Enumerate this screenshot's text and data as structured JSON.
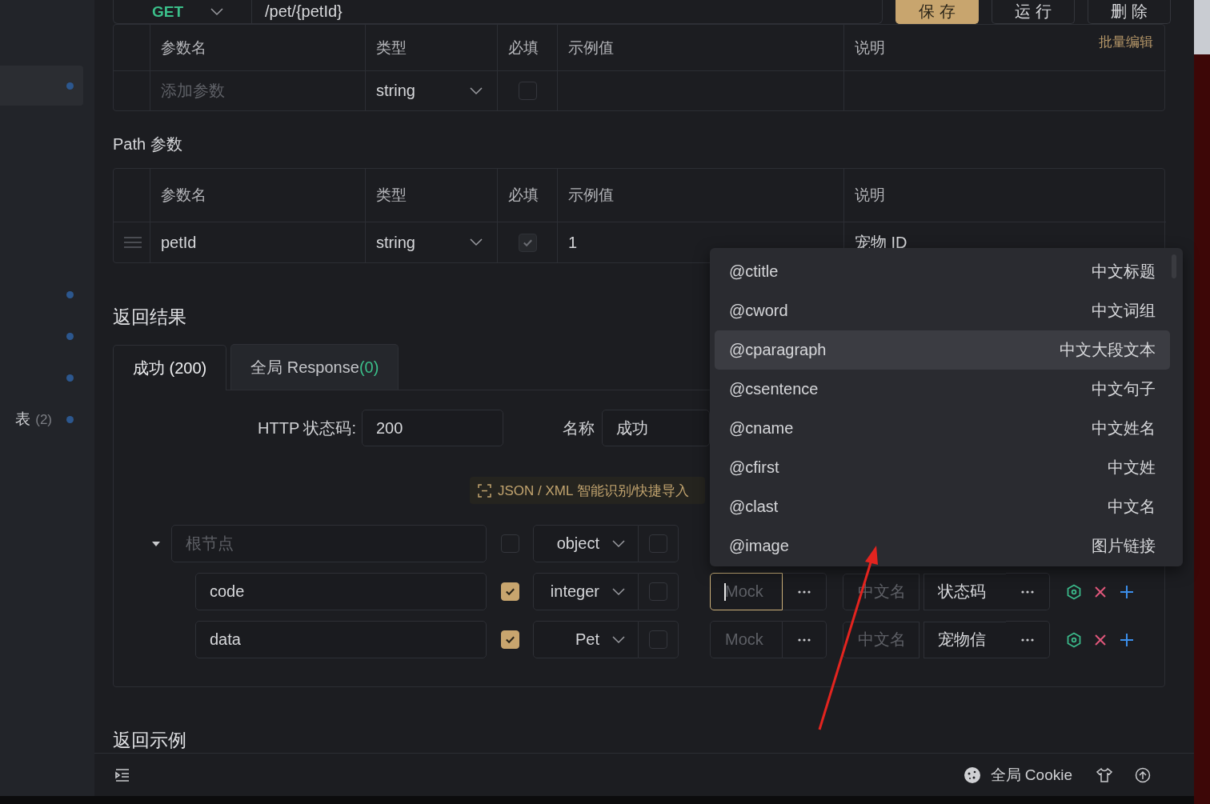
{
  "sidebar": {
    "items": [
      {
        "selected": true
      },
      {
        "selected": false
      },
      {
        "selected": false
      },
      {
        "selected": false
      },
      {
        "label": "表",
        "count": "(2)",
        "selected": false
      }
    ]
  },
  "request": {
    "method": "GET",
    "url": "/pet/{petId}",
    "buttons": [
      {
        "label": "保 存",
        "kind": "primary"
      },
      {
        "label": "运 行",
        "kind": "default"
      },
      {
        "label": "删 除",
        "kind": "default"
      }
    ]
  },
  "query_params": {
    "batch_edit": "批量编辑",
    "columns": [
      "参数名",
      "类型",
      "必填",
      "示例值",
      "说明"
    ],
    "rows": [
      {
        "name_placeholder": "添加参数",
        "type": "string",
        "required": false
      }
    ]
  },
  "path_params": {
    "title": "Path 参数",
    "columns": [
      "参数名",
      "类型",
      "必填",
      "示例值",
      "说明"
    ],
    "rows": [
      {
        "name": "petId",
        "type": "string",
        "required": true,
        "disabled": true,
        "example": "1",
        "description": "宠物 ID"
      }
    ]
  },
  "response": {
    "title": "返回结果",
    "tabs": [
      {
        "label": "成功 (200)",
        "selected": true
      },
      {
        "label": "全局 Response",
        "count": "(0)",
        "selected": false
      }
    ],
    "status_label": "HTTP 状态码:",
    "status_code": "200",
    "name_label": "名称",
    "name": "成功",
    "import_button": "JSON / XML 智能识别/快捷导入",
    "schema": {
      "expanded": true,
      "placeholder": "根节点",
      "required": false,
      "type": "object",
      "checkbox_2_checked": false,
      "children": [
        {
          "name": "code",
          "required": true,
          "type": "integer",
          "checkbox_2_checked": false,
          "mock_placeholder": "Mock",
          "focused": true,
          "title_placeholder": "中文名",
          "description": "状态码"
        },
        {
          "name": "data",
          "required": true,
          "type": "Pet",
          "checkbox_2_checked": false,
          "mock_placeholder": "Mock",
          "focused": false,
          "title_placeholder": "中文名",
          "description": "宠物信"
        }
      ]
    }
  },
  "mock_menu": {
    "items": [
      {
        "value": "@ctitle",
        "label": "中文标题",
        "selected": false
      },
      {
        "value": "@cword",
        "label": "中文词组",
        "selected": false
      },
      {
        "value": "@cparagraph",
        "label": "中文大段文本",
        "selected": true
      },
      {
        "value": "@csentence",
        "label": "中文句子",
        "selected": false
      },
      {
        "value": "@cname",
        "label": "中文姓名",
        "selected": false
      },
      {
        "value": "@cfirst",
        "label": "中文姓",
        "selected": false
      },
      {
        "value": "@clast",
        "label": "中文名",
        "selected": false
      },
      {
        "value": "@image",
        "label": "图片链接",
        "selected": false
      }
    ]
  },
  "example_title": "返回示例",
  "status_bar": {
    "cookie_label": "全局 Cookie"
  }
}
